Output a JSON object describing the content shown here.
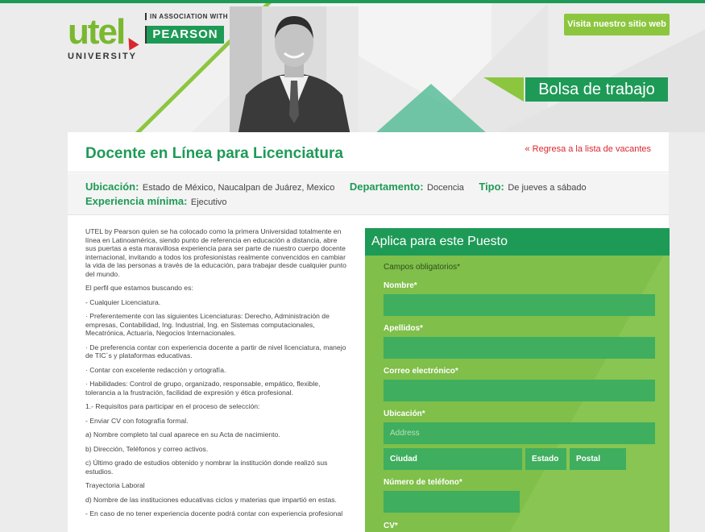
{
  "header": {
    "logo_text": "utel",
    "logo_sub": "UNIVERSITY",
    "assoc_text": "IN ASSOCIATION WITH",
    "pearson_text": "PEARSON",
    "visit_button": "Visita nuestro sitio web",
    "banner_title": "Bolsa de trabajo"
  },
  "job": {
    "title": "Docente en Línea para Licenciatura",
    "back_link": "« Regresa a la lista de vacantes",
    "location_label": "Ubicación:",
    "location_value": "Estado de México, Naucalpan de Juárez, Mexico",
    "department_label": "Departamento:",
    "department_value": "Docencia",
    "type_label": "Tipo:",
    "type_value": "De jueves a sábado",
    "experience_label": "Experiencia mínima:",
    "experience_value": "Ejecutivo"
  },
  "description": [
    "UTEL by Pearson  quien se ha colocado como la primera Universidad totalmente en línea en Latinoamérica, siendo punto de referencia en educación a distancia, abre sus puertas a esta maravillosa experiencia para ser parte de nuestro cuerpo docente internacional, invitando a todos los profesionistas realmente convencidos en cambiar la vida de las personas a través de la educación, para trabajar desde cualquier punto del mundo.",
    "El perfil que estamos buscando es:",
    "- Cualquier Licenciatura.",
    "·          Preferentemente con las siguientes Licenciaturas: Derecho, Administración de empresas, Contabilidad, Ing. Industrial, Ing. en Sistemas computacionales, Mecatrónica, Actuaría, Negocios Internacionales.",
    "·          De preferencia contar con experiencia docente a partir de nivel licenciatura, manejo de TIC´s y plataformas educativas.",
    "·          Contar con excelente redacción y ortografía.",
    "·          Habilidades: Control de grupo, organizado, responsable, empático, flexible, tolerancia a la frustración, facilidad de expresión y ética profesional.",
    "1.- Requisitos para participar en el proceso de selección:",
    " - Enviar CV con fotografía formal.",
    "a) Nombre completo tal cual aparece en su Acta de nacimiento.",
    "b) Dirección, Teléfonos y correo activos.",
    "c) Último grado de estudios obtenido y nombrar la institución donde realizó sus estudios.",
    "Trayectoria Laboral",
    "d) Nombre de las instituciones educativas ciclos y materias que impartió en estas.",
    "- En caso de no tener experiencia docente podrá contar con experiencia profesional"
  ],
  "form": {
    "title": "Aplica para este Puesto",
    "required_note": "Campos obligatorios*",
    "name_label": "Nombre*",
    "surname_label": "Apellidos*",
    "email_label": "Correo electrónico*",
    "location_label": "Ubicación*",
    "address_placeholder": "Address",
    "city_label": "Ciudad",
    "state_label": "Estado",
    "postal_label": "Postal",
    "phone_label": "Número de teléfono*",
    "cv_label": "CV*"
  },
  "colors": {
    "brand_green": "#1e9a57",
    "light_green": "#8cc63f",
    "form_green": "#7fbf4a",
    "link_red": "#d9272e"
  }
}
